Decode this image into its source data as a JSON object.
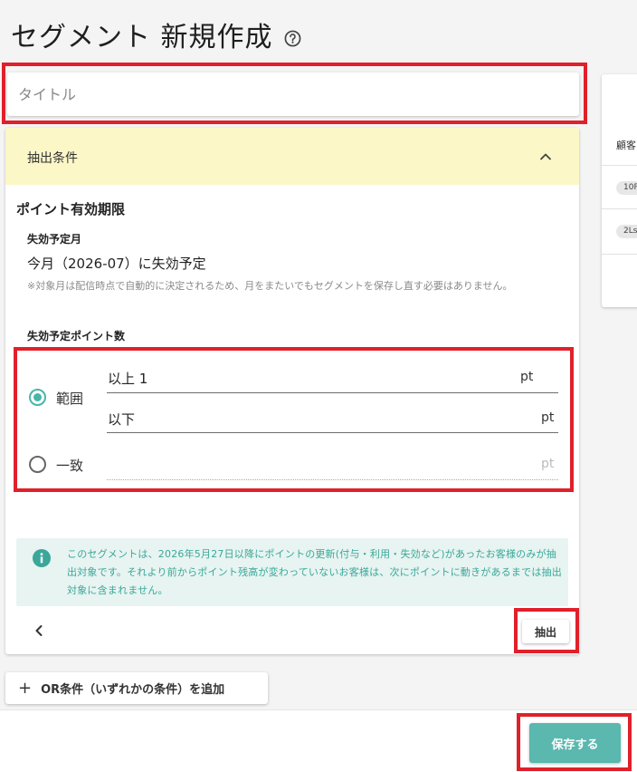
{
  "page": {
    "title": "セグメント 新規作成"
  },
  "title_field": {
    "placeholder": "タイトル",
    "value": ""
  },
  "condition": {
    "header": "抽出条件",
    "section_title": "ポイント有効期限",
    "month_label": "失効予定月",
    "month_value": "今月（2026-07）に失効予定",
    "note": "※対象月は配信時点で自動的に決定されるため、月をまたいでもセグメントを保存し直す必要はありません。",
    "points_label": "失効予定ポイント数",
    "range": {
      "label": "範囲",
      "selected": true,
      "min_value": "以上 1",
      "max_value": "以下",
      "unit": "pt"
    },
    "exact": {
      "label": "一致",
      "selected": false,
      "value": "",
      "unit": "pt"
    },
    "info": "このセグメントは、2026年5月27日以降にポイントの更新(付与・利用・失効など)があったお客様のみが抽出対象です。それより前からポイント残高が変わっていないお客様は、次にポイントに動きがあるまでは抽出対象に含まれません。",
    "extract_label": "抽出"
  },
  "add_or_label": "OR条件（いずれかの条件）を追加",
  "save_label": "保存する",
  "side_panel": {
    "header": "顧客",
    "chips": [
      "10P",
      "2Ls"
    ]
  },
  "colors": {
    "accent": "#5ab8ae",
    "header_bg": "#fbf7c7",
    "info_bg": "#e7f4f1",
    "highlight": "#e0202a"
  }
}
